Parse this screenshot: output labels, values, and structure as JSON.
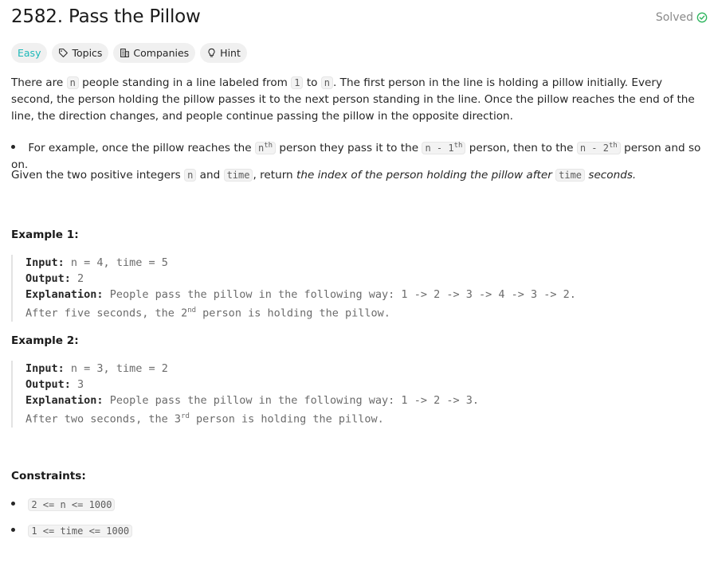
{
  "problem": {
    "title": "2582. Pass the Pillow",
    "status": "Solved",
    "chips": {
      "difficulty": "Easy",
      "topics": "Topics",
      "companies": "Companies",
      "hint": "Hint"
    }
  },
  "description": {
    "p1_a": "There are",
    "p1_code_n": "n",
    "p1_b": "people standing in a line labeled from",
    "p1_code_1": "1",
    "p1_c": "to",
    "p1_code_n2": "n",
    "p1_d": ". The first person in the line is holding a pillow initially. Every second, the person holding the pillow passes it to the next person standing in the line. Once the pillow reaches the end of the line, the direction changes, and people continue passing the pillow in the opposite direction.",
    "bullet_a": "For example, once the pillow reaches the",
    "bullet_code1": "n",
    "bullet_sup1": "th",
    "bullet_b": "person they pass it to the",
    "bullet_code2": "n - 1",
    "bullet_sup2": "th",
    "bullet_c": "person, then to the",
    "bullet_code3": "n - 2",
    "bullet_sup3": "th",
    "bullet_d": "person and so on.",
    "p2_a": "Given the two positive integers",
    "p2_code_n": "n",
    "p2_b": "and",
    "p2_code_time": "time",
    "p2_c": ", return",
    "p2_em": "the index of the person holding the pillow after",
    "p2_code_time2": "time",
    "p2_em2": "seconds."
  },
  "examples": [
    {
      "heading": "Example 1:",
      "input_label": "Input:",
      "input_value": "n = 4, time = 5",
      "output_label": "Output:",
      "output_value": "2",
      "explanation_label": "Explanation:",
      "explanation_line1": "People pass the pillow in the following way: 1 -> 2 -> 3 -> 4 -> 3 -> 2.",
      "explanation_line2_a": "After five seconds, the 2",
      "explanation_line2_sup": "nd",
      "explanation_line2_b": " person is holding the pillow."
    },
    {
      "heading": "Example 2:",
      "input_label": "Input:",
      "input_value": "n = 3, time = 2",
      "output_label": "Output:",
      "output_value": "3",
      "explanation_label": "Explanation:",
      "explanation_line1": "People pass the pillow in the following way: 1 -> 2 -> 3.",
      "explanation_line2_a": "After two seconds, the 3",
      "explanation_line2_sup": "rd",
      "explanation_line2_b": " person is holding the pillow."
    }
  ],
  "constraints": {
    "heading": "Constraints:",
    "items": [
      "2 <= n <= 1000",
      "1 <= time <= 1000"
    ]
  },
  "colors": {
    "easy": "#1cb8b8",
    "solved_check": "#2db55d"
  },
  "icons": {
    "solved": "check-circle-icon",
    "topics": "tag-icon",
    "companies": "building-icon",
    "hint": "lightbulb-icon"
  }
}
